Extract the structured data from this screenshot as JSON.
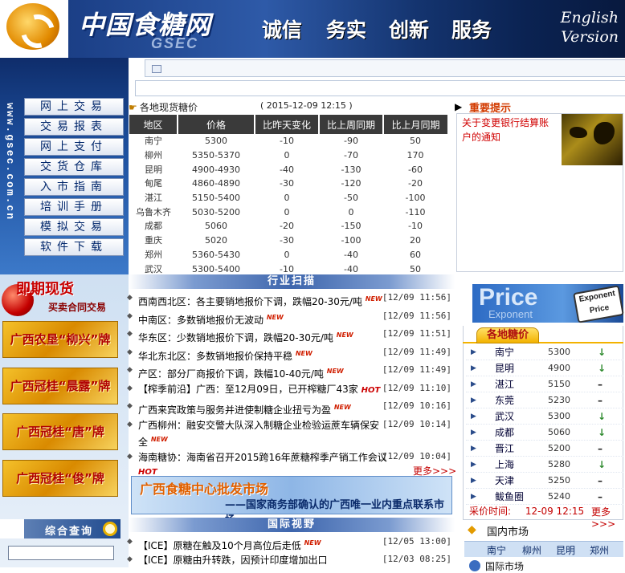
{
  "header": {
    "logo_cn": "中国食糖网",
    "logo_en": "GSEC",
    "slogans": [
      "诚信",
      "务实",
      "创新",
      "服务"
    ],
    "english_version": [
      "English",
      "Version"
    ]
  },
  "site_url_vertical": "www.gsec.com.cn",
  "nav": [
    "网上交易",
    "交易报表",
    "网上支付",
    "交货仓库",
    "入市指南",
    "培训手册",
    "模拟交易",
    "软件下载"
  ],
  "spot_prices": {
    "title": "各地现货糖价",
    "date": "( 2015-12-09 12:15 )",
    "columns": [
      "地区",
      "价格",
      "比昨天变化",
      "比上周同期",
      "比上月同期"
    ],
    "rows": [
      [
        "南宁",
        "5300",
        "-10",
        "-90",
        "50"
      ],
      [
        "柳州",
        "5350-5370",
        "0",
        "-70",
        "170"
      ],
      [
        "昆明",
        "4900-4930",
        "-40",
        "-130",
        "-60"
      ],
      [
        "甸尾",
        "4860-4890",
        "-30",
        "-120",
        "-20"
      ],
      [
        "湛江",
        "5150-5400",
        "0",
        "-50",
        "-100"
      ],
      [
        "乌鲁木齐",
        "5030-5200",
        "0",
        "0",
        "-110"
      ],
      [
        "成都",
        "5060",
        "-20",
        "-150",
        "-10"
      ],
      [
        "重庆",
        "5020",
        "-30",
        "-100",
        "20"
      ],
      [
        "郑州",
        "5360-5430",
        "0",
        "-40",
        "60"
      ],
      [
        "武汉",
        "5300-5400",
        "-10",
        "-40",
        "50"
      ]
    ]
  },
  "notice": {
    "title": "重要提示",
    "link": "关于变更银行结算账户的通知"
  },
  "spot_banner": {
    "title": "即期现货",
    "subtitle": "买卖合同交易"
  },
  "brands": [
    "广西农垦“柳兴”牌",
    "广西冠桂“晨露”牌",
    "广西冠桂“唐”牌",
    "广西冠桂“俊”牌"
  ],
  "query": {
    "title": "综合查询"
  },
  "industry": {
    "title": "行业扫描",
    "items": [
      {
        "text": "西南西北区：各主要销地报价下调，跌幅20-30元/吨",
        "tag": "NEW",
        "date": "[12/09 11:56]"
      },
      {
        "text": "中南区：多数销地报价无波动",
        "tag": "NEW",
        "date": "[12/09 11:56]"
      },
      {
        "text": "华东区：少数销地报价下调，跌幅20-30元/吨",
        "tag": "NEW",
        "date": "[12/09 11:51]"
      },
      {
        "text": "华北东北区：多数销地报价保持平稳",
        "tag": "NEW",
        "date": "[12/09 11:49]"
      },
      {
        "text": "产区：部分厂商报价下调，跌幅10-40元/吨",
        "tag": "NEW",
        "date": "[12/09 11:49]"
      },
      {
        "text": "【榨季前沿】广西：至12月09日，已开榨糖厂43家",
        "tag": "HOT",
        "date": "[12/09 11:10]"
      },
      {
        "text": "广西来宾政策与服务并进使制糖企业扭亏为盈",
        "tag": "NEW",
        "date": "[12/09 10:16]"
      },
      {
        "text": "广西柳州：融安交警大队深入制糖企业检验运蔗车辆保安全",
        "tag": "NEW",
        "date": "[12/09 10:14]"
      },
      {
        "text": "海南糖协：海南省召开2015跨16年蔗糖榨季产销工作会议",
        "tag": "HOT",
        "date": "[12/09 10:04]"
      }
    ],
    "more": "更多>>>"
  },
  "wholesale_banner": {
    "title": "广西食糖中心批发市场",
    "subtitle": "——国家商务部确认的广西唯一业内重点联系市场"
  },
  "international": {
    "title": "国际视野",
    "items": [
      {
        "text": "【ICE】原糖在触及10个月高位后走低",
        "tag": "NEW",
        "date": "[12/05 13:00]"
      },
      {
        "text": "【ICE】原糖由升转跌，因预计印度增加出口",
        "tag": "",
        "date": "[12/03 08:25]"
      }
    ]
  },
  "price_exponent": {
    "big": "Price",
    "small": "Exponent",
    "tag_top": "Exponent",
    "tag_bottom": "Price"
  },
  "regional_prices": {
    "title": "各地糖价",
    "rows": [
      {
        "city": "南宁",
        "price": "5300",
        "trend": "↓"
      },
      {
        "city": "昆明",
        "price": "4900",
        "trend": "↓"
      },
      {
        "city": "湛江",
        "price": "5150",
        "trend": "–"
      },
      {
        "city": "东莞",
        "price": "5230",
        "trend": "–"
      },
      {
        "city": "武汉",
        "price": "5300",
        "trend": "↓"
      },
      {
        "city": "成都",
        "price": "5060",
        "trend": "↓"
      },
      {
        "city": "晋江",
        "price": "5200",
        "trend": "–"
      },
      {
        "city": "上海",
        "price": "5280",
        "trend": "↓"
      },
      {
        "city": "天津",
        "price": "5250",
        "trend": "–"
      },
      {
        "city": "鲅鱼圈",
        "price": "5240",
        "trend": "–"
      }
    ],
    "time_label": "采价时间:",
    "time": "12-09 12:15",
    "more": "更多>>>"
  },
  "domestic": {
    "title": "国内市场",
    "cities": [
      "南宁",
      "柳州",
      "昆明",
      "郑州"
    ]
  },
  "intl_market": {
    "title": "国际市场"
  }
}
